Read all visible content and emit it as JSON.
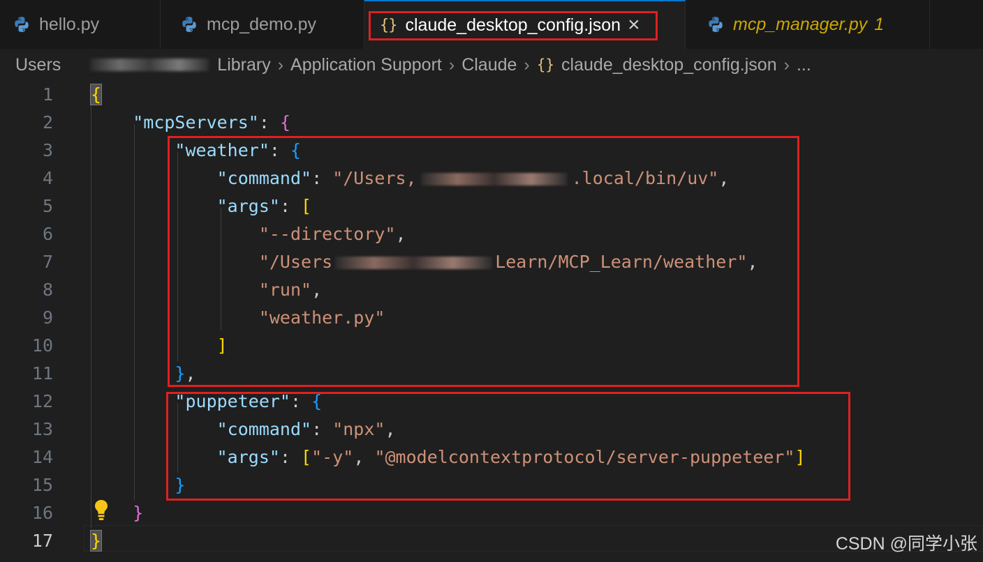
{
  "tabs": [
    {
      "label": "hello.py",
      "type": "python"
    },
    {
      "label": "mcp_demo.py",
      "type": "python"
    },
    {
      "label": "claude_desktop_config.json",
      "type": "json",
      "active": true,
      "close": "×"
    },
    {
      "label": "mcp_manager.py",
      "type": "python",
      "badge": "1"
    }
  ],
  "breadcrumb": {
    "items": [
      "Users",
      "Library",
      "Application Support",
      "Claude",
      "claude_desktop_config.json",
      "..."
    ],
    "separator": "›",
    "json_icon": "{}"
  },
  "editor": {
    "line_numbers": [
      "1",
      "2",
      "3",
      "4",
      "5",
      "6",
      "7",
      "8",
      "9",
      "10",
      "11",
      "12",
      "13",
      "14",
      "15",
      "16",
      "17"
    ],
    "current_line": "17",
    "keys": {
      "mcpServers": "\"mcpServers\"",
      "weather": "\"weather\"",
      "command": "\"command\"",
      "args": "\"args\"",
      "puppeteer": "\"puppeteer\""
    },
    "values": {
      "weather_command_prefix": "\"/Users,",
      "weather_command_suffix": ".local/bin/uv\"",
      "arg_directory": "\"--directory\"",
      "arg_path_prefix": "\"/Users",
      "arg_path_suffix": "Learn/MCP_Learn/weather\"",
      "arg_run": "\"run\"",
      "arg_script": "\"weather.py\"",
      "puppeteer_command": "\"npx\"",
      "puppeteer_arg_y": "\"-y\"",
      "puppeteer_arg_pkg": "\"@modelcontextprotocol/server-puppeteer\""
    }
  },
  "icons": {
    "python": "python-file-icon",
    "json": "json-file-icon",
    "lightbulb": "lightbulb-icon"
  },
  "colors": {
    "highlight_box": "#e02020",
    "tab_accent": "#0078d4"
  },
  "watermark": "CSDN @同学小张"
}
